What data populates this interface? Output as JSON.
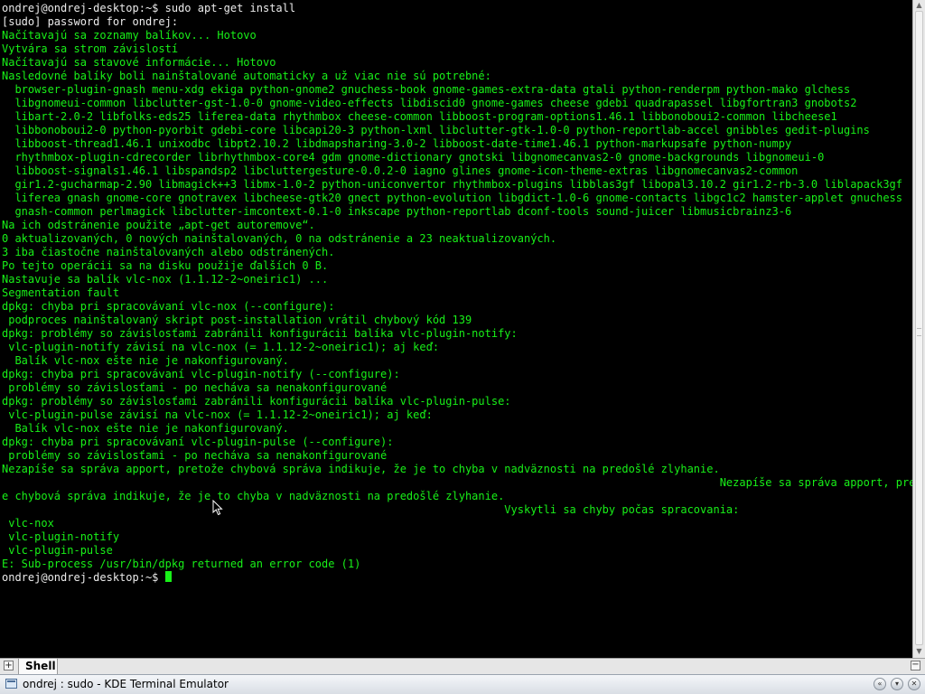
{
  "terminal": {
    "lines": [
      {
        "text": "ondrej@ondrej-desktop:~$ sudo apt-get install",
        "color": "white"
      },
      {
        "text": "[sudo] password for ondrej:",
        "color": "white"
      },
      {
        "text": "Načítavajú sa zoznamy balíkov... Hotovo",
        "color": "green"
      },
      {
        "text": "Vytvára sa strom závislostí",
        "color": "green"
      },
      {
        "text": "Načítavajú sa stavové informácie... Hotovo",
        "color": "green"
      },
      {
        "text": "Nasledovné balíky boli nainštalované automaticky a už viac nie sú potrebné:",
        "color": "green"
      },
      {
        "text": "  browser-plugin-gnash menu-xdg ekiga python-gnome2 gnuchess-book gnome-games-extra-data gtali python-renderpm python-mako glchess",
        "color": "green"
      },
      {
        "text": "  libgnomeui-common libclutter-gst-1.0-0 gnome-video-effects libdiscid0 gnome-games cheese gdebi quadrapassel libgfortran3 gnobots2",
        "color": "green"
      },
      {
        "text": "  libart-2.0-2 libfolks-eds25 liferea-data rhythmbox cheese-common libboost-program-options1.46.1 libbonoboui2-common libcheese1",
        "color": "green"
      },
      {
        "text": "  libbonoboui2-0 python-pyorbit gdebi-core libcapi20-3 python-lxml libclutter-gtk-1.0-0 python-reportlab-accel gnibbles gedit-plugins",
        "color": "green"
      },
      {
        "text": "  libboost-thread1.46.1 unixodbc libpt2.10.2 libdmapsharing-3.0-2 libboost-date-time1.46.1 python-markupsafe python-numpy",
        "color": "green"
      },
      {
        "text": "  rhythmbox-plugin-cdrecorder librhythmbox-core4 gdm gnome-dictionary gnotski libgnomecanvas2-0 gnome-backgrounds libgnomeui-0",
        "color": "green"
      },
      {
        "text": "  libboost-signals1.46.1 libspandsp2 libcluttergesture-0.0.2-0 iagno glines gnome-icon-theme-extras libgnomecanvas2-common",
        "color": "green"
      },
      {
        "text": "  gir1.2-gucharmap-2.90 libmagick++3 libmx-1.0-2 python-uniconvertor rhythmbox-plugins libblas3gf libopal3.10.2 gir1.2-rb-3.0 liblapack3gf",
        "color": "green"
      },
      {
        "text": "  liferea gnash gnome-core gnotravex libcheese-gtk20 gnect python-evolution libgdict-1.0-6 gnome-contacts libgc1c2 hamster-applet gnuchess",
        "color": "green"
      },
      {
        "text": "  gnash-common perlmagick libclutter-imcontext-0.1-0 inkscape python-reportlab dconf-tools sound-juicer libmusicbrainz3-6",
        "color": "green"
      },
      {
        "text": "Na ich odstránenie použite „apt-get autoremove“.",
        "color": "green"
      },
      {
        "text": "0 aktualizovaných, 0 nových nainštalovaných, 0 na odstránenie a 23 neaktualizovaných.",
        "color": "green"
      },
      {
        "text": "3 iba čiastočne nainštalovaných alebo odstránených.",
        "color": "green"
      },
      {
        "text": "Po tejto operácii sa na disku použije ďalších 0 B.",
        "color": "green"
      },
      {
        "text": "Nastavuje sa balík vlc-nox (1.1.12-2~oneiric1) ...",
        "color": "green"
      },
      {
        "text": "Segmentation fault",
        "color": "green"
      },
      {
        "text": "dpkg: chyba pri spracovávaní vlc-nox (--configure):",
        "color": "green"
      },
      {
        "text": " podproces nainštalovaný skript post-installation vrátil chybový kód 139",
        "color": "green"
      },
      {
        "text": "dpkg: problémy so závislosťami zabránili konfigurácii balíka vlc-plugin-notify:",
        "color": "green"
      },
      {
        "text": " vlc-plugin-notify závisí na vlc-nox (= 1.1.12-2~oneiric1); aj keď:",
        "color": "green"
      },
      {
        "text": "  Balík vlc-nox ešte nie je nakonfigurovaný.",
        "color": "green"
      },
      {
        "text": "dpkg: chyba pri spracovávaní vlc-plugin-notify (--configure):",
        "color": "green"
      },
      {
        "text": " problémy so závislosťami - po nechá­va sa nenakonfigurované",
        "color": "green"
      },
      {
        "text": "dpkg: problémy so závislosťami zabránili konfigurácii balíka vlc-plugin-pulse:",
        "color": "green"
      },
      {
        "text": " vlc-plugin-pulse závisí na vlc-nox (= 1.1.12-2~oneiric1); aj keď:",
        "color": "green"
      },
      {
        "text": "  Balík vlc-nox ešte nie je nakonfigurovaný.",
        "color": "green"
      },
      {
        "text": "dpkg: chyba pri spracovávaní vlc-plugin-pulse (--configure):",
        "color": "green"
      },
      {
        "text": " problémy so závislosťami - po nechá­va sa nenakonfigurované",
        "color": "green"
      },
      {
        "text": "Nezapíše sa správa apport, pretože chybová správa indikuje, že je to chyba v nadväznosti na predošlé zlyhanie.",
        "color": "green"
      },
      {
        "text": "                                                                                                              Nezapíše sa správa apport, pretož",
        "color": "green"
      },
      {
        "text": "e chybová správa indikuje, že je to chyba v nadväznosti na predošlé zlyhanie.",
        "color": "green"
      },
      {
        "text": "                                                                             Vyskytli sa chyby počas spracovania:",
        "color": "green"
      },
      {
        "text": " vlc-nox",
        "color": "green"
      },
      {
        "text": " vlc-plugin-notify",
        "color": "green"
      },
      {
        "text": " vlc-plugin-pulse",
        "color": "green"
      },
      {
        "text": "E: Sub-process /usr/bin/dpkg returned an error code (1)",
        "color": "green"
      },
      {
        "text": "ondrej@ondrej-desktop:~$ ",
        "color": "white",
        "cursor": true
      }
    ]
  },
  "tabbar": {
    "new_tab_icon": "+",
    "tabs": [
      {
        "label": "Shell",
        "active": true
      }
    ],
    "close_tab_icon": "−"
  },
  "taskbar": {
    "app_icon": "terminal-icon",
    "window_title": "ondrej : sudo - KDE Terminal Emulator",
    "buttons": [
      {
        "name": "keep-above-button",
        "icon": "«"
      },
      {
        "name": "minimize-button",
        "icon": "▾"
      },
      {
        "name": "close-button",
        "icon": "✕"
      }
    ]
  },
  "colors": {
    "terminal_bg": "#000000",
    "terminal_green": "#18f018",
    "terminal_white": "#ececec"
  }
}
